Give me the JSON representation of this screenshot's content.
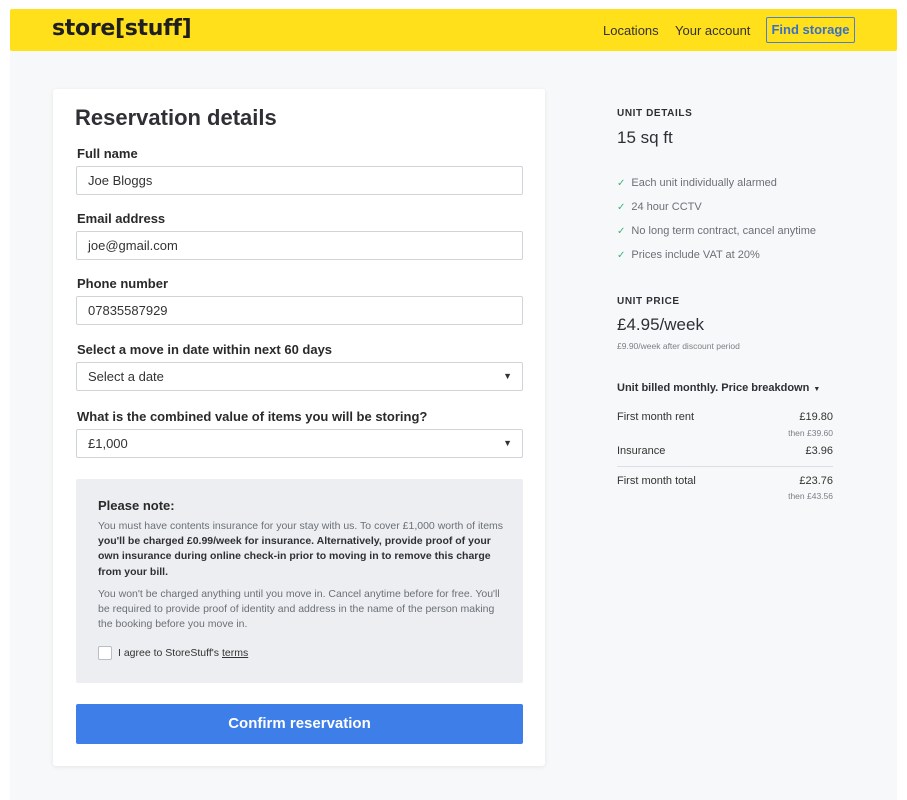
{
  "header": {
    "logo": "store[stuff]",
    "nav": {
      "locations": "Locations",
      "account": "Your account"
    },
    "find_storage": "Find storage"
  },
  "form": {
    "title": "Reservation details",
    "full_name": {
      "label": "Full name",
      "value": "Joe Bloggs"
    },
    "email": {
      "label": "Email address",
      "value": "joe@gmail.com"
    },
    "phone": {
      "label": "Phone number",
      "value": "07835587929"
    },
    "move_in": {
      "label": "Select a move in date within next 60 days",
      "value": "Select a date"
    },
    "value_of_items": {
      "label": "What is the combined value of items you will be storing?",
      "value": "£1,000"
    },
    "note": {
      "title": "Please note:",
      "p1_plain": "You must have contents insurance for your stay with us. To cover £1,000 worth of items ",
      "p1_bold": "you'll be charged £0.99/week for insurance. Alternatively, provide proof of your own insurance during online check-in prior to moving in to remove this charge from your bill.",
      "p2": "You won't be charged anything until you move in. Cancel anytime before for free. You'll be required to provide proof of identity and address in the name of the person making the booking before you move in.",
      "agree_text": "I agree to StoreStuff's ",
      "terms": "terms"
    },
    "confirm": "Confirm reservation"
  },
  "unit": {
    "details_heading": "UNIT DETAILS",
    "size": "15 sq ft",
    "features": [
      "Each unit individually alarmed",
      "24 hour CCTV",
      "No long term contract, cancel anytime",
      "Prices include VAT at 20%"
    ],
    "price_heading": "UNIT PRICE",
    "price": "£4.95/week",
    "price_note": "£9.90/week after discount period",
    "breakdown_label": "Unit billed monthly. Price breakdown",
    "rows": {
      "rent_label": "First month rent",
      "rent_value": "£19.80",
      "rent_then": "then £39.60",
      "insurance_label": "Insurance",
      "insurance_value": "£3.96",
      "total_label": "First month total",
      "total_value": "£23.76",
      "total_then": "then £43.56"
    }
  },
  "colors": {
    "header_bg": "#ffe01b",
    "accent": "#3d7ee8",
    "check": "#3fb07a"
  },
  "icons": {
    "check": "check-icon",
    "caret": "caret-down-icon"
  }
}
